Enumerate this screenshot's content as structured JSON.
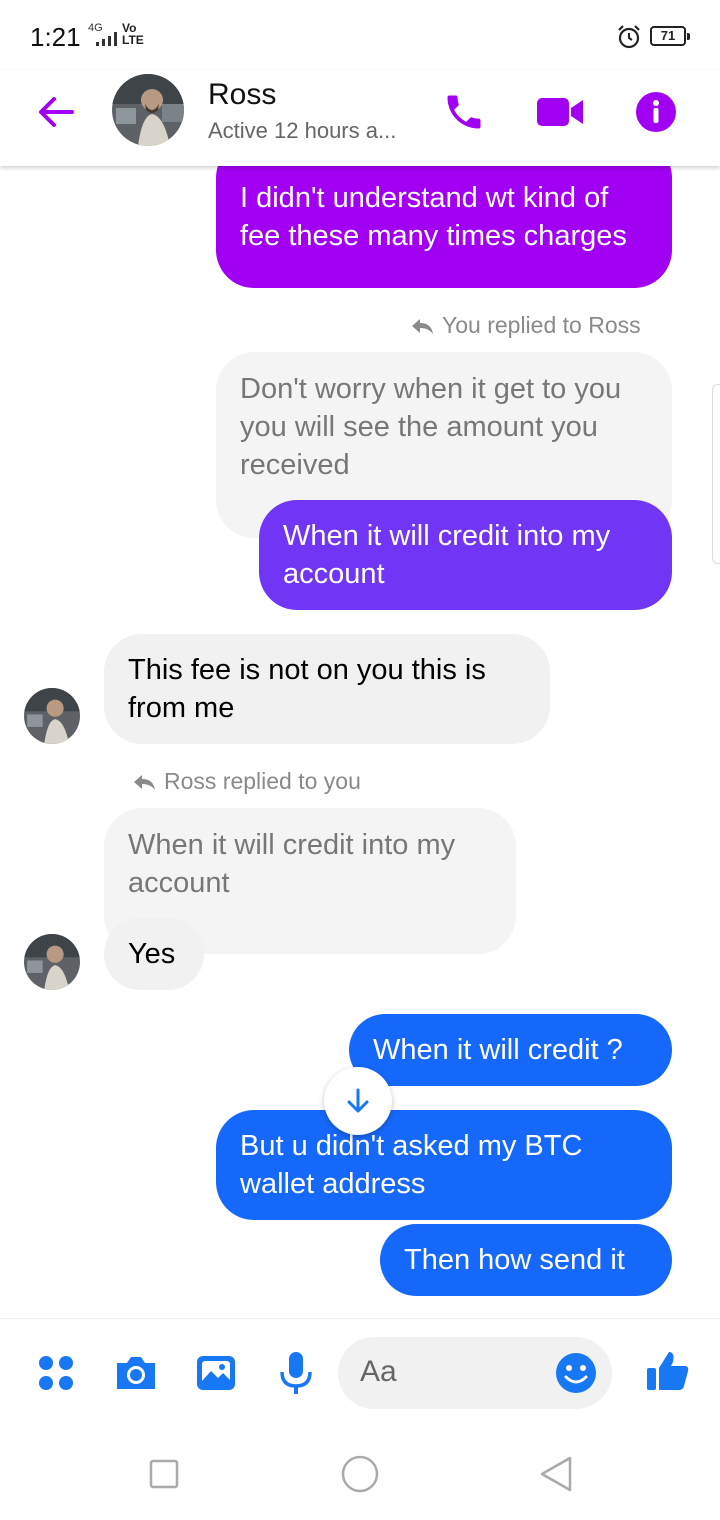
{
  "status_bar": {
    "time": "1:21",
    "network": "4G",
    "volte": "Vo\nLTE",
    "battery": "71"
  },
  "header": {
    "contact_name": "Ross",
    "contact_status": "Active 12 hours a..."
  },
  "messages": [
    {
      "text": "I didn't understand wt kind of fee these many times charges",
      "sender": "me"
    },
    {
      "reply_note": "You replied to Ross"
    },
    {
      "text": "Don't worry when it get to you you will see the amount you received",
      "sender": "Ross",
      "quoted": true
    },
    {
      "text": "When it will credit into my account",
      "sender": "me"
    },
    {
      "text": "This fee is not on you this is from me",
      "sender": "Ross"
    },
    {
      "reply_note": "Ross replied to you"
    },
    {
      "text": "When it will credit into my account",
      "sender": "me",
      "quoted": true
    },
    {
      "text": "Yes",
      "sender": "Ross"
    },
    {
      "text": "When it will credit ?",
      "sender": "me"
    },
    {
      "text": "But u didn't asked my BTC wallet address",
      "sender": "me"
    },
    {
      "text": "Then how send it",
      "sender": "me"
    }
  ],
  "composer": {
    "placeholder": "Aa"
  },
  "colors": {
    "accent": "#a200f2",
    "bubble_purple": "#a200f2",
    "bubble_violet": "#7135f5",
    "bubble_blue": "#1668fa",
    "bubble_incoming": "#f1f1f1",
    "composer_blue": "#1877f2"
  },
  "icons": {
    "header": [
      "back-arrow-icon",
      "phone-icon",
      "video-camera-icon",
      "info-icon"
    ],
    "composer": [
      "menu-dots-icon",
      "camera-icon",
      "image-icon",
      "microphone-icon",
      "emoji-icon",
      "thumbs-up-icon"
    ],
    "navigation": [
      "recent-apps-icon",
      "home-icon",
      "back-icon"
    ]
  }
}
